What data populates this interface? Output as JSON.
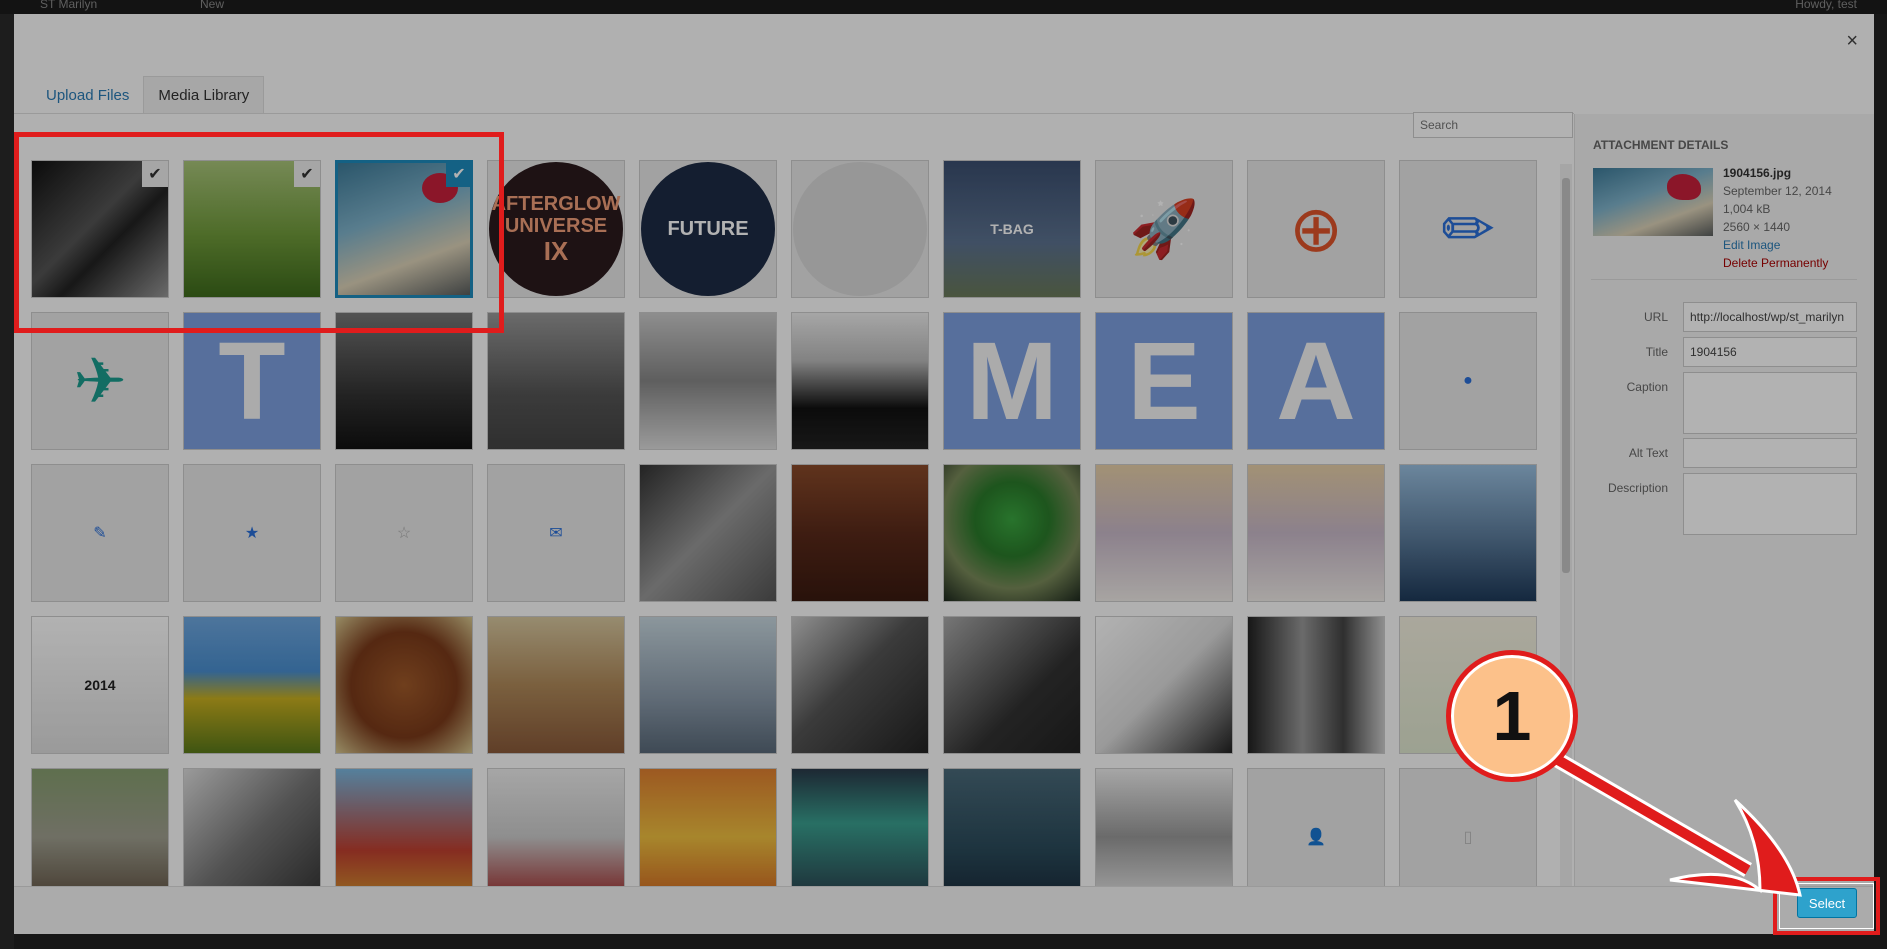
{
  "adminbar": {
    "site": "ST Marilyn",
    "new_label": "New",
    "howdy": "Howdy, test"
  },
  "modal": {
    "close_label": "×"
  },
  "tabs": [
    {
      "label": "Upload Files",
      "active": false
    },
    {
      "label": "Media Library",
      "active": true
    }
  ],
  "search": {
    "placeholder": "Search"
  },
  "grid": {
    "tiles": [
      {
        "kind": "photo",
        "bg": "linear-gradient(135deg,#111 0%,#555 45%,#222 60%,#999 100%)",
        "selected": false,
        "checked": true
      },
      {
        "kind": "photo",
        "bg": "linear-gradient(180deg,#a9c57a 0%,#6f9a3a 55%,#3e6b1c 100%)",
        "selected": false,
        "checked": true
      },
      {
        "kind": "photo",
        "bg": "linear-gradient(160deg,#3e7c9a 0%,#7fb3cb 40%,#dcd2b8 70%,#5a5e5e 100%)",
        "selected": true,
        "checked": true,
        "accent": "#c8203c"
      },
      {
        "kind": "circle",
        "bg": "#2b1a1e",
        "text": "AFTERGLOW UNIVERSE",
        "sub": "IX",
        "color": "#f2a07a"
      },
      {
        "kind": "circle",
        "bg": "#1d2b45",
        "text": "FUTURE",
        "sub": "",
        "color": "#ffffff"
      },
      {
        "kind": "circle",
        "bg": "#d8d8d8",
        "text": "",
        "sub": "",
        "color": "#333"
      },
      {
        "kind": "photo",
        "bg": "linear-gradient(180deg,#3b4f70 0%,#5c7290 60%,#6a7a5a 100%)",
        "text": "T-BAG",
        "color": "#fff"
      },
      {
        "kind": "icon",
        "glyph": "🚀",
        "color": "#6a97b0"
      },
      {
        "kind": "icon",
        "glyph": "⊕",
        "color": "#e0542a",
        "big": true
      },
      {
        "kind": "icon",
        "glyph": "✏",
        "color": "#2a6fd8",
        "big": true
      },
      {
        "kind": "icon",
        "glyph": "✈",
        "color": "#1b9c8f",
        "big": true
      },
      {
        "kind": "letter",
        "glyph": "T",
        "bg": "#7d9fe0"
      },
      {
        "kind": "photo",
        "bg": "linear-gradient(180deg,#777 0%,#333 60%,#111 100%)"
      },
      {
        "kind": "photo",
        "bg": "linear-gradient(180deg,#999 0%,#555 60%,#444 100%)"
      },
      {
        "kind": "photo",
        "bg": "linear-gradient(180deg,#ccc 0%,#888 50%,#ddd 100%)"
      },
      {
        "kind": "photo",
        "bg": "linear-gradient(180deg,#eee 0%,#bbb 35%,#111 70%,#222 100%)"
      },
      {
        "kind": "letter",
        "glyph": "M",
        "bg": "#7d9fe0"
      },
      {
        "kind": "letter",
        "glyph": "E",
        "bg": "#7d9fe0"
      },
      {
        "kind": "letter",
        "glyph": "A",
        "bg": "#7d9fe0"
      },
      {
        "kind": "icon",
        "glyph": "●",
        "color": "#2a6fd8",
        "small": true
      },
      {
        "kind": "icon",
        "glyph": "✎",
        "color": "#2a6fd8",
        "small": true
      },
      {
        "kind": "icon",
        "glyph": "★",
        "color": "#2a6fd8",
        "small": true
      },
      {
        "kind": "icon",
        "glyph": "☆",
        "color": "#aaaaaa",
        "small": true
      },
      {
        "kind": "icon",
        "glyph": "✉",
        "color": "#2a6fd8",
        "small": true
      },
      {
        "kind": "photo",
        "bg": "linear-gradient(135deg,#333 0%,#999 50%,#555 100%)"
      },
      {
        "kind": "photo",
        "bg": "linear-gradient(180deg,#8a4a2a 0%,#5a2a1a 50%,#3a1a10 100%)"
      },
      {
        "kind": "photo",
        "bg": "radial-gradient(circle at 50% 40%,#3aa640 0%,#2a7a2a 35%,#7a8a5a 65%,#1e2a1e 100%)"
      },
      {
        "kind": "photo",
        "bg": "linear-gradient(180deg,#e8d0a8 0%,#c9b9c9 50%,#f0ece8 100%)"
      },
      {
        "kind": "photo",
        "bg": "linear-gradient(180deg,#e8d0a8 0%,#c9b9c9 50%,#f0ece8 100%)"
      },
      {
        "kind": "photo",
        "bg": "linear-gradient(180deg,#9ac0e0 0%,#5a7a9a 55%,#1e3a5a 100%)"
      },
      {
        "kind": "photo",
        "bg": "linear-gradient(180deg,#fff 0%,#ddd 100%)",
        "text": "2014",
        "color": "#222"
      },
      {
        "kind": "photo",
        "bg": "linear-gradient(180deg,#6fa8e0 0%,#4a8fd0 40%,#c9b020 60%,#5a7a1a 100%)"
      },
      {
        "kind": "photo",
        "bg": "radial-gradient(circle at 50% 50%,#a05a2a 0%,#7a3a1a 55%,#d8c890 100%)"
      },
      {
        "kind": "photo",
        "bg": "linear-gradient(180deg,#d8c8a0 0%,#b08a5a 50%,#8a5a3a 100%)"
      },
      {
        "kind": "photo",
        "bg": "linear-gradient(180deg,#c8d8e0 0%,#8a9aaa 60%,#5a6a7a 100%)"
      },
      {
        "kind": "photo",
        "bg": "linear-gradient(135deg,#ccc 0%,#555 45%,#222 100%)"
      },
      {
        "kind": "photo",
        "bg": "linear-gradient(135deg,#aaa 0%,#333 60%,#222 100%)"
      },
      {
        "kind": "photo",
        "bg": "linear-gradient(135deg,#fff 0%,#ddd 50%,#222 100%)"
      },
      {
        "kind": "photo",
        "bg": "linear-gradient(90deg,#222 0%,#999 40%,#444 70%,#ccc 100%)"
      },
      {
        "kind": "photo",
        "bg": "linear-gradient(180deg,#f4f0e0 0%,#e0e8d0 100%)"
      },
      {
        "kind": "photo",
        "bg": "linear-gradient(180deg,#88a070 0%,#a0a090 50%,#605040 100%)"
      },
      {
        "kind": "photo",
        "bg": "linear-gradient(135deg,#ddd 0%,#777 50%,#333 100%)"
      },
      {
        "kind": "photo",
        "bg": "linear-gradient(180deg,#7ab8e0 0%,#c04030 60%,#d8a030 100%)"
      },
      {
        "kind": "photo",
        "bg": "linear-gradient(180deg,#eee 0%,#ccc 50%,#a02020 100%)"
      },
      {
        "kind": "photo",
        "bg": "linear-gradient(180deg,#e08030 0%,#f0c040 50%,#d06020 100%)"
      },
      {
        "kind": "photo",
        "bg": "linear-gradient(180deg,#2a3a4a 0%,#3aa090 40%,#2a3a4a 100%)"
      },
      {
        "kind": "photo",
        "bg": "linear-gradient(180deg,#4a6a7a 0%,#2a4a5a 60%,#1a2a3a 100%)"
      },
      {
        "kind": "photo",
        "bg": "linear-gradient(180deg,#eee 0%,#999 50%,#eee 100%)"
      },
      {
        "kind": "icon",
        "glyph": "👤",
        "color": "#bbbbbb",
        "small": true
      },
      {
        "kind": "icon",
        "glyph": "▯",
        "color": "#bbbbbb",
        "small": true
      }
    ]
  },
  "sidebar": {
    "title": "ATTACHMENT DETAILS",
    "filename": "1904156.jpg",
    "date": "September 12, 2014",
    "size": "1,004 kB",
    "dims": "2560 × 1440",
    "edit": "Edit Image",
    "delete": "Delete Permanently",
    "fields": {
      "url_label": "URL",
      "url_value": "http://localhost/wp/st_marilyn",
      "title_label": "Title",
      "title_value": "1904156",
      "caption_label": "Caption",
      "alt_label": "Alt Text",
      "desc_label": "Description"
    }
  },
  "footer": {
    "select_label": "Select"
  },
  "callout": {
    "number": "1"
  },
  "colors": {
    "accent": "#1e8cbe",
    "link": "#2a7bb5",
    "delete": "#a00",
    "annotation": "#e01c1c"
  }
}
